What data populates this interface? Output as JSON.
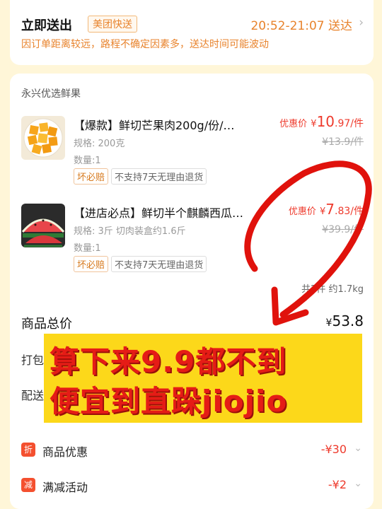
{
  "delivery": {
    "title": "立即送出",
    "tag": "美团快送",
    "time": "20:52-21:07 送达",
    "note": "因订单距离较远，路程不确定因素多，送达时间可能波动"
  },
  "store": {
    "name": "永兴优选鲜果"
  },
  "items": [
    {
      "title": "【爆款】鲜切芒果肉200g/份/…",
      "spec": "规格: 200克",
      "qty": "数量:1",
      "badge_guarantee": "坏必赔",
      "badge_norefund": "不支持7天无理由退货",
      "price_label": "优惠价",
      "price_currency": "¥",
      "price_int": "10",
      "price_dec": ".97",
      "price_unit": "/件",
      "original_price": "¥13.9/件"
    },
    {
      "title": "【进店必点】鲜切半个麒麟西瓜…",
      "spec": "规格: 3斤 切肉装盒约1.6斤",
      "qty": "数量:1",
      "badge_guarantee": "坏必赔",
      "badge_norefund": "不支持7天无理由退货",
      "price_label": "优惠价",
      "price_currency": "¥",
      "price_int": "7",
      "price_dec": ".83",
      "price_unit": "/件",
      "original_price": "¥39.9/件"
    }
  ],
  "summary": {
    "count_weight": "共2件 约1.7kg",
    "total_label": "商品总价",
    "total_currency": "¥",
    "total_value": "53.8",
    "pack_label": "打包",
    "delivery_label": "配送"
  },
  "discounts": [
    {
      "icon": "折",
      "label": "商品优惠",
      "value": "-¥30"
    },
    {
      "icon": "减",
      "label": "满减活动",
      "value": "-¥2"
    }
  ],
  "overlay": {
    "line1": "算下来9.9都不到",
    "line2": "便宜到直跺jiojio"
  },
  "colors": {
    "accent_orange": "#e8832c",
    "price_red": "#ee3a2c",
    "overlay_yellow": "#fcd81a",
    "overlay_text": "#e51c16"
  }
}
